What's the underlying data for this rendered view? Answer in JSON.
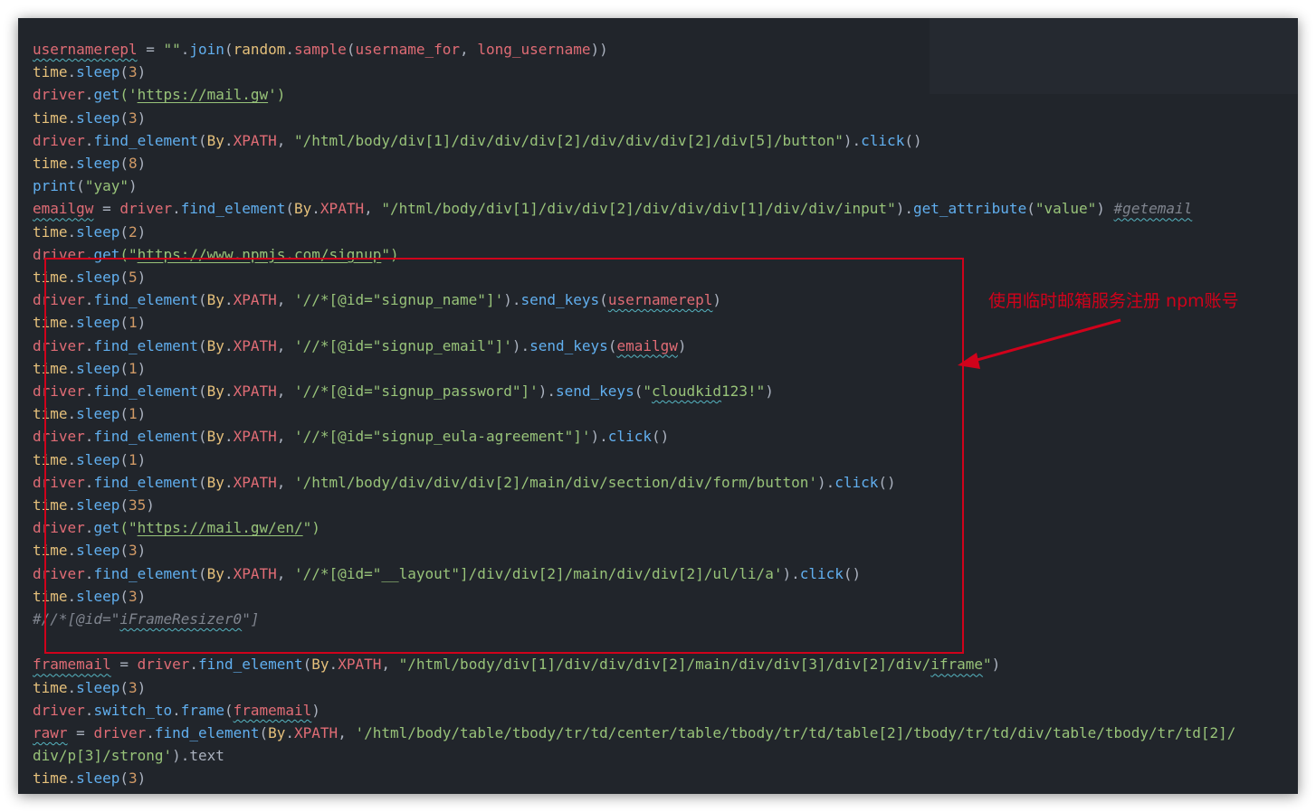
{
  "colors": {
    "background": "#21252b",
    "variable": "#e06c75",
    "function": "#61afef",
    "string": "#98c379",
    "class": "#e5c07b",
    "number": "#d19a66",
    "annotation": "#d0021b"
  },
  "annotation": {
    "text": "使用临时邮箱服务注册 npm账号"
  },
  "code": {
    "l1": [
      "usernamerepl",
      " = ",
      "\"\"",
      ".",
      "join",
      "(",
      "random",
      ".",
      "sample",
      "(",
      "username_for",
      ", ",
      "long_username",
      "))"
    ],
    "l2": [
      "time",
      ".",
      "sleep",
      "(",
      "3",
      ")"
    ],
    "l3": [
      "driver",
      ".",
      "get",
      "('",
      "https://mail.gw",
      "')"
    ],
    "l4": [
      "time",
      ".",
      "sleep",
      "(",
      "3",
      ")"
    ],
    "l5": [
      "driver",
      ".",
      "find_element",
      "(",
      "By",
      ".",
      "XPATH",
      ", ",
      "\"/html/body/div[1]/div/div/div[2]/div/div/div[2]/div[5]/button\"",
      ").",
      "click",
      "()"
    ],
    "l6": [
      "time",
      ".",
      "sleep",
      "(",
      "8",
      ")"
    ],
    "l7": [
      "print",
      "(",
      "\"yay\"",
      ")"
    ],
    "l8": [
      "emailgw",
      " = ",
      "driver",
      ".",
      "find_element",
      "(",
      "By",
      ".",
      "XPATH",
      ", ",
      "\"/html/body/div[1]/div/div[2]/div/div/div[1]/div/div/input\"",
      ").",
      "get_attribute",
      "(",
      "\"value\"",
      ") ",
      "#getemail"
    ],
    "l9": [
      "time",
      ".",
      "sleep",
      "(",
      "2",
      ")"
    ],
    "l10": [
      "driver",
      ".",
      "get",
      "(\"",
      "https://www.npmjs.com/signup",
      "\")"
    ],
    "l11": [
      "time",
      ".",
      "sleep",
      "(",
      "5",
      ")"
    ],
    "l12": [
      "driver",
      ".",
      "find_element",
      "(",
      "By",
      ".",
      "XPATH",
      ", ",
      "'//*[@id=\"signup_name\"]'",
      ").",
      "send_keys",
      "(",
      "usernamerepl",
      ")"
    ],
    "l13": [
      "time",
      ".",
      "sleep",
      "(",
      "1",
      ")"
    ],
    "l14": [
      "driver",
      ".",
      "find_element",
      "(",
      "By",
      ".",
      "XPATH",
      ", ",
      "'//*[@id=\"signup_email\"]'",
      ").",
      "send_keys",
      "(",
      "emailgw",
      ")"
    ],
    "l15": [
      "time",
      ".",
      "sleep",
      "(",
      "1",
      ")"
    ],
    "l16": [
      "driver",
      ".",
      "find_element",
      "(",
      "By",
      ".",
      "XPATH",
      ", ",
      "'//*[@id=\"signup_password\"]'",
      ").",
      "send_keys",
      "(",
      "\"",
      "cloudkid",
      "123!\"",
      ")"
    ],
    "l17": [
      "time",
      ".",
      "sleep",
      "(",
      "1",
      ")"
    ],
    "l18": [
      "driver",
      ".",
      "find_element",
      "(",
      "By",
      ".",
      "XPATH",
      ", ",
      "'//*[@id=\"signup_eula-agreement\"]'",
      ").",
      "click",
      "()"
    ],
    "l19": [
      "time",
      ".",
      "sleep",
      "(",
      "1",
      ")"
    ],
    "l20": [
      "driver",
      ".",
      "find_element",
      "(",
      "By",
      ".",
      "XPATH",
      ", ",
      "'/html/body/div/div/div[2]/main/div/section/div/form/button'",
      ").",
      "click",
      "()"
    ],
    "l21": [
      "time",
      ".",
      "sleep",
      "(",
      "35",
      ")"
    ],
    "l22": [
      "driver",
      ".",
      "get",
      "(\"",
      "https://mail.gw/en/",
      "\")"
    ],
    "l23": [
      "time",
      ".",
      "sleep",
      "(",
      "3",
      ")"
    ],
    "l24": [
      "driver",
      ".",
      "find_element",
      "(",
      "By",
      ".",
      "XPATH",
      ", ",
      "'//*[@id=\"__layout\"]/div/div[2]/main/div/div[2]/ul/li/a'",
      ").",
      "click",
      "()"
    ],
    "l25": [
      "time",
      ".",
      "sleep",
      "(",
      "3",
      ")"
    ],
    "l26": [
      "#//*[@id=\"",
      "iFrameResizer0",
      "\"]"
    ],
    "l27": [
      ""
    ],
    "l28": [
      "framemail",
      " = ",
      "driver",
      ".",
      "find_element",
      "(",
      "By",
      ".",
      "XPATH",
      ", ",
      "\"/html/body/div[1]/div/div/div[2]/main/div/div[3]/div[2]/div/",
      "iframe",
      "\"",
      ")"
    ],
    "l29": [
      "time",
      ".",
      "sleep",
      "(",
      "3",
      ")"
    ],
    "l30": [
      "driver",
      ".",
      "switch_to",
      ".",
      "frame",
      "(",
      "framemail",
      ")"
    ],
    "l31": [
      "rawr",
      " = ",
      "driver",
      ".",
      "find_element",
      "(",
      "By",
      ".",
      "XPATH",
      ", ",
      "'/html/body/table/tbody/tr/td/center/table/tbody/tr/td/table[2]/tbody/tr/td/div/table/tbody/tr/td[2]/"
    ],
    "l32": [
      "div/p[3]/strong'",
      ").",
      "text"
    ],
    "l33": [
      "time",
      ".",
      "sleep",
      "(",
      "3",
      ")"
    ]
  }
}
